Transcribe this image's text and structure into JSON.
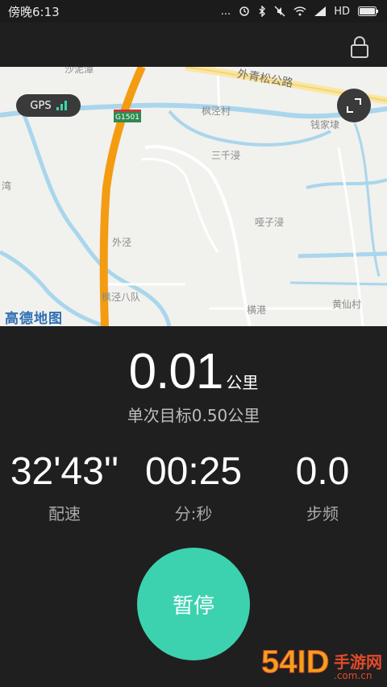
{
  "status_bar": {
    "time": "傍晚6:13",
    "dots": "...",
    "network": "HD"
  },
  "map": {
    "gps_label": "GPS",
    "road_shield": "G1501",
    "logo": "高德地图",
    "labels": [
      "外青松公路",
      "枫泾村",
      "钱家埭",
      "三千浸",
      "哑子浸",
      "外泾",
      "枫泾八队",
      "横港",
      "黄仙村",
      "湾",
      "沙泥潭"
    ]
  },
  "run": {
    "distance": "0.01",
    "distance_unit": "公里",
    "goal": "单次目标0.50公里"
  },
  "stats": [
    {
      "value": "32'43''",
      "label": "配速"
    },
    {
      "value": "00:25",
      "label": "分:秒"
    },
    {
      "value": "0.0",
      "label": "步频"
    }
  ],
  "pause_label": "暂停",
  "watermark": {
    "big": "54ID",
    "text": "手游网",
    "url": ".com.cn"
  },
  "colors": {
    "accent": "#3cd2b0",
    "background": "#1f1f1f",
    "route": "#f39c12"
  }
}
